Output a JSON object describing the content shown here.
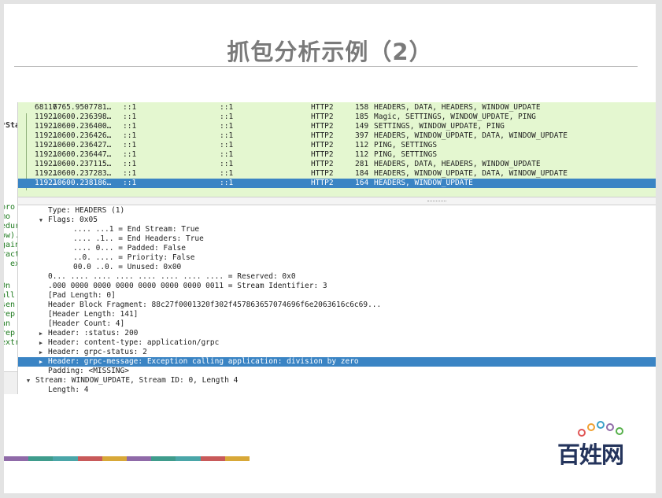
{
  "slide": {
    "title": "抓包分析示例（2）",
    "logo_text": "百姓网",
    "bar_colors": [
      "#8f6aa8",
      "#3f9c8c",
      "#4aa6a8",
      "#c85a5a",
      "#d8a838",
      "#8f6aa8",
      "#3f9c8c",
      "#4aa6a8",
      "#c85a5a",
      "#d8a838"
    ],
    "logo_dot_colors": [
      "#e05656",
      "#f0a030",
      "#3aa0c8",
      "#8f6aa8",
      "#56b04a"
    ]
  },
  "left_strip": [
    "*Sta",
    "pro",
    " mo",
    "edur",
    "ow).",
    "gain",
    "ract",
    ", ex",
    "  On",
    "all",
    "sen",
    "rep",
    "  an",
    "rep",
    "extr"
  ],
  "packets": [
    {
      "no": "68117",
      "time": "6765.9507781…",
      "src": "::1",
      "dst": "::1",
      "proto": "HTTP2",
      "len": "158",
      "info": "HEADERS, DATA, HEADERS, WINDOW_UPDATE"
    },
    {
      "no": "1192…",
      "time": "10600.236398…",
      "src": "::1",
      "dst": "::1",
      "proto": "HTTP2",
      "len": "185",
      "info": "Magic, SETTINGS, WINDOW_UPDATE, PING"
    },
    {
      "no": "1192…",
      "time": "10600.236400…",
      "src": "::1",
      "dst": "::1",
      "proto": "HTTP2",
      "len": "149",
      "info": "SETTINGS, WINDOW_UPDATE, PING"
    },
    {
      "no": "1192…",
      "time": "10600.236426…",
      "src": "::1",
      "dst": "::1",
      "proto": "HTTP2",
      "len": "397",
      "info": "HEADERS, WINDOW_UPDATE, DATA, WINDOW_UPDATE"
    },
    {
      "no": "1192…",
      "time": "10600.236427…",
      "src": "::1",
      "dst": "::1",
      "proto": "HTTP2",
      "len": "112",
      "info": "PING, SETTINGS"
    },
    {
      "no": "1192…",
      "time": "10600.236447…",
      "src": "::1",
      "dst": "::1",
      "proto": "HTTP2",
      "len": "112",
      "info": "PING, SETTINGS"
    },
    {
      "no": "1192…",
      "time": "10600.237115…",
      "src": "::1",
      "dst": "::1",
      "proto": "HTTP2",
      "len": "281",
      "info": "HEADERS, DATA, HEADERS, WINDOW_UPDATE"
    },
    {
      "no": "1192…",
      "time": "10600.237283…",
      "src": "::1",
      "dst": "::1",
      "proto": "HTTP2",
      "len": "184",
      "info": "HEADERS, WINDOW_UPDATE, DATA, WINDOW_UPDATE"
    },
    {
      "no": "1192…",
      "time": "10600.238186…",
      "src": "::1",
      "dst": "::1",
      "proto": "HTTP2",
      "len": "164",
      "info": "HEADERS, WINDOW_UPDATE"
    }
  ],
  "selected_packet": 8,
  "details": [
    {
      "text": "Type: HEADERS (1)",
      "indent": 2,
      "twisty": ""
    },
    {
      "text": "Flags: 0x05",
      "indent": 2,
      "twisty": "open"
    },
    {
      "text": ".... ...1 = End Stream: True",
      "indent": 4,
      "twisty": ""
    },
    {
      "text": ".... .1.. = End Headers: True",
      "indent": 4,
      "twisty": ""
    },
    {
      "text": ".... 0... = Padded: False",
      "indent": 4,
      "twisty": ""
    },
    {
      "text": "..0. .... = Priority: False",
      "indent": 4,
      "twisty": ""
    },
    {
      "text": "00.0 ..0. = Unused: 0x00",
      "indent": 4,
      "twisty": ""
    },
    {
      "text": "0... .... .... .... .... .... .... .... = Reserved: 0x0",
      "indent": 2,
      "twisty": ""
    },
    {
      "text": ".000 0000 0000 0000 0000 0000 0000 0011 = Stream Identifier: 3",
      "indent": 2,
      "twisty": ""
    },
    {
      "text": "[Pad Length: 0]",
      "indent": 2,
      "twisty": ""
    },
    {
      "text": "Header Block Fragment: 88c27f0001320f302f457863657074696f6e2063616c6c69...",
      "indent": 2,
      "twisty": ""
    },
    {
      "text": "[Header Length: 141]",
      "indent": 2,
      "twisty": ""
    },
    {
      "text": "[Header Count: 4]",
      "indent": 2,
      "twisty": ""
    },
    {
      "text": "Header: :status: 200",
      "indent": 2,
      "twisty": "closed"
    },
    {
      "text": "Header: content-type: application/grpc",
      "indent": 2,
      "twisty": "closed"
    },
    {
      "text": "Header: grpc-status: 2",
      "indent": 2,
      "twisty": "closed"
    },
    {
      "text": "Header: grpc-message: Exception calling application: division by zero",
      "indent": 2,
      "twisty": "closed"
    },
    {
      "text": "Padding: <MISSING>",
      "indent": 2,
      "twisty": ""
    },
    {
      "text": "Stream: WINDOW_UPDATE, Stream ID: 0, Length 4",
      "indent": 1,
      "twisty": "open"
    },
    {
      "text": "Length: 4",
      "indent": 2,
      "twisty": ""
    }
  ],
  "selected_detail": 16
}
